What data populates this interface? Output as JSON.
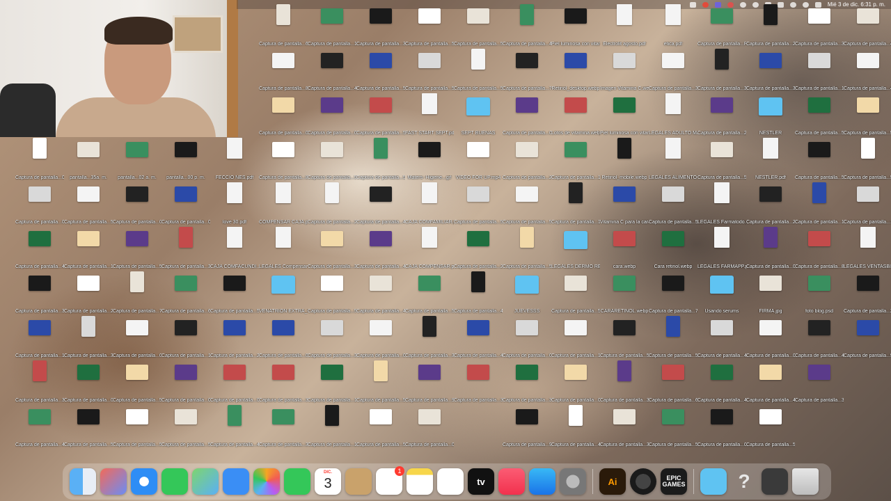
{
  "menubar": {
    "clock": "Mié 3 de dic. 6:31 p. m.",
    "icons": [
      "folder-icon",
      "recording-icon",
      "screen-icon",
      "record-icon",
      "chat-icon",
      "moon-icon",
      "bluetooth-icon",
      "wifi-icon",
      "search-icon",
      "user-icon",
      "control-center-icon"
    ]
  },
  "desktop": {
    "columns": [
      [
        "Captura de pantalla...07p. m.",
        "Captura de pantalla...0.1 p. m.",
        "Captura de pantalla...46 p. m.",
        "Captura de pantalla...33 p. m.",
        "Captura de pantalla...1.20 p. m.",
        "Captura de pantalla...3.15 a. m.",
        "Captura de pantalla...49 a. m.",
        "Captura de pantalla...54 a. m."
      ],
      [
        "pantalla...35a. m.",
        "Captura de pantalla...58 a. m.",
        "Captura de pantalla...1.40 a. m.",
        "Captura de pantalla...22 a. m.",
        "Captura de pantalla...39 a. m.",
        "Captura de pantalla...04 p. m.",
        "Captura de pantalla...53 a. m.",
        "Captura de pantalla...43 a. m."
      ],
      [
        "pantalla...02 a. m.",
        "Captura de pantalla...03 p. m.",
        "Captura de pantalla...57 a. m.",
        "Captura de pantalla...7.29 a. m.",
        "Captura de pantalla...0.31 a. m.",
        "Captura de pantalla...54 p. m.",
        "Captura de pantalla...53 a. m.",
        "Captura de pantalla...8.14 a. m."
      ],
      [
        "pantalla...00 p. m.",
        "Captura de pantalla...07 p. m.",
        "Captura de pantalla...3.12 p. m.",
        "Captura de pantalla...6.15 a. m.",
        "Captura de pantalla...1.00 a. m.",
        "Captura de pantalla...08 p. m.",
        "Captura de pantalla...55 a. m.",
        "Captura de pantalla...48 a. m."
      ],
      [
        "FECCIO NES.pdf",
        "love 30.pdf",
        "CAJA COMFACUNDI...pdf",
        "Captura de pantalla...57 a. m.",
        "Captura de pantalla...26 p. m.",
        "Captura de pantalla...04 a. m.",
        "Captura de pantalla...44 a. m.",
        "Captura de pantalla...2.51 a. m."
      ],
      [
        "Captura de pantalla...68 a. m.",
        "Captura de pantalla...82 a. m.",
        "Captura de pantalla...03 a. m.",
        "Captura de pantalla...8.15 p. m.",
        "COMPENSAR CAJA.pdf",
        "LEGALES Compensar.pdf",
        "VENATRIÓN EXTRA_Carpeta",
        "Captura de pantalla...04 p. m.",
        "Captura de pantalla...32 a. m.",
        "Captura de pantalla...38 a. m."
      ],
      [
        "Captura de pantalla...1.03 a. m.",
        "Captura de pantalla...4.15 a. m.",
        "Captura de pantalla...0.13 a. m.",
        "Captura de pantalla...59 p. m.",
        "Captura de pantalla...29 p. m.",
        "Captura de pantalla...38 p. m.",
        "Captura de pantalla...51 p. m.",
        "Captura de pantalla...37 p. m.",
        "Captura de pantalla...13 a. m.",
        "Captura de pantalla...1.29 a. m."
      ],
      [
        "Captura de pantalla...3.18 a. m.",
        "Captura de pantalla...59 p. m.",
        "Captura de pantalla...56 p. m.",
        "Captura de pantalla...59 p. m.",
        "Captura de pantalla...45 p. m.",
        "Captura de pantalla...49 a. m.",
        "Captura de pantalla...48 a. m.",
        "Captura de pantalla...04 p. m.",
        "Captura de pantalla...58 a. m.",
        "Captura de pantalla...5.19 p. m."
      ],
      [
        "Captura de pantalla...53 p. m.",
        "Captura de pantalla...59 p. m.",
        "FAST START SEPT.pdf",
        "Maters- Higiene...gif",
        "CAJA COMFAMILIAR.pdf",
        "CAJA COMPENSAR.pdf",
        "Captura de pantalla...52 p. m.",
        "Captura de pantalla...3.22 a. m.",
        "Captura de pantalla...9.31 p. m.",
        "Captura de pantalla...00 p. m."
      ],
      [
        "Captura de pantalla...54 p. m.",
        "Captura de pantalla...57 a. m.",
        "SEPT BUENAS",
        "VIDEO FOR UP.mp4",
        "Captura de pantalla...55 p. m.",
        "Captura de pantalla...25 p. m.",
        "Captura de pantalla...4.1 a. m.",
        "Captura de pantalla...45 p. m.",
        "Captura de pantalla...39 p. m."
      ],
      [
        "Captura de pantalla...47 p. m.",
        "Captura de pantalla...7.57 p. m.",
        "Captura de pantalla...09 p. m.",
        "Captura de pantalla...27 p. m.",
        "Captura de pantalla...55 p. m.",
        "Captura de pantalla...55 p. m.",
        "JUEVESSS",
        "Captura de pantalla...0.16 a. m.",
        "Captura de pantalla...34 p. m.",
        "Captura de pantalla...9.21 p. m."
      ],
      [
        "Piel luminosa con vitamina C.webp",
        "Retinol_desktop.webp",
        "Lotos de vitamina.webp",
        "Captura de pantalla...1.41 p. m.",
        "Captura de pantalla...1.23 a. m.",
        "LEGALES DERMO RECARGADO",
        "Captura de pantalla...58 p. m.",
        "Captura de pantalla...1.03 p. m.",
        "Captura de pantalla...08 p. m.",
        "Captura de pantalla...42 p. m."
      ],
      [
        "Electrolit agosto.pdf",
        "Imagen Vitamina C.webp",
        "Piel luminosa con vitamina C.webp",
        "Retinol_mobile.webp",
        "Vitamina C para la cara.webp",
        "cara.webp",
        "CARARETINOL.webp",
        "Captura de pantalla...57 p. m.",
        "Captura de pantalla...30 p. m.",
        "Captura de pantalla...3.18 p. m."
      ],
      [
        "etica.pdf",
        "Captura de pantalla...35 p. m.",
        "LEGALES ADULTO MAYOR.pdf",
        "LEGALES ALIMENTOS.pdf",
        "Captura de pantalla...58 p. m.",
        "Cara retinol.webp",
        "Captura de pantalla...7.35 p. m.",
        "Captura de pantalla...5.10 p. m.",
        "Captura de pantalla...6.10 p. m.",
        "Captura de pantalla...54 p. m."
      ],
      [
        "Captura de pantalla...PARA",
        "Captura de pantalla...3.48 a. m.",
        "Captura de pantalla...27 p. m.",
        "Captura de pantalla...50 p. m.",
        "LEGALES Farmatodo.pdf",
        "LEGALES FARMAPP.pdf",
        "Usando serums",
        "Captura de pantalla...43 p. m.",
        "Captura de pantalla...46 p. m.",
        "Captura de pantalla...02 p. m."
      ],
      [
        "Captura de pantalla...26 p. m.",
        "Captura de pantalla...3.31 p. m.",
        "NESTLER",
        "NESTLER.pdf",
        "Captura de pantalla...22 p. m.",
        "Captura de pantalla...07 p. m.",
        "FIRMA.jpg",
        "Captura de pantalla...07 p. m.",
        "Captura de pantalla...41 p. m.",
        "Captura de pantalla...5.41 p. m."
      ],
      [
        "Captura de pantalla...39 p. m.",
        "Captura de pantalla...18 p. m.",
        "Captura de pantalla...55 p. m.",
        "Captura de pantalla...52 p. m.",
        "Captura de pantalla...12 p. m.",
        "Captura de pantalla...8.17 p. m.",
        "foto blog.psd",
        "Captura de pantalla...40 p. m.",
        "Captura de pantalla...35 p. m."
      ],
      [
        "Captura de pantalla...45 p. m.",
        "Captura de pantalla...44 p. m.",
        "Captura de pantalla...50 p. m.",
        "Captura de pantalla...55 p. m.",
        "Captura de pantalla...13 p. m.",
        "LEGALES VENTASBIEN.pdf",
        "Captura de pantalla...20 p. m.",
        "Captura de pantalla...9.15 p. m."
      ]
    ]
  },
  "dock": {
    "calendar_month": "DIC.",
    "calendar_day": "3",
    "reminders_badge": "1",
    "ai_label": "Ai",
    "epic_label": "EPIC GAMES",
    "tv_label": "tv",
    "help_label": "?",
    "apps": [
      "finder",
      "launchpad",
      "safari",
      "messages",
      "maps",
      "mail",
      "photos",
      "facetime",
      "calendar",
      "contacts",
      "reminders",
      "notes",
      "freeform",
      "tv",
      "music",
      "app-store",
      "system-settings",
      "illustrator",
      "obs",
      "epic-games",
      "downloads-folder",
      "help",
      "screenshot",
      "trash"
    ]
  }
}
